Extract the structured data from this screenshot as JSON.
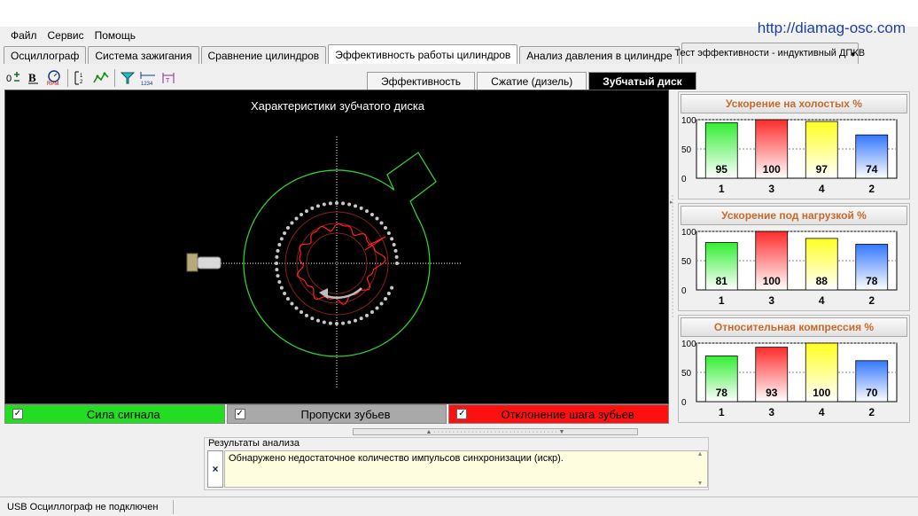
{
  "watermark": "http://diamag-osc.com",
  "menu": [
    "Файл",
    "Сервис",
    "Помощь"
  ],
  "main_tabs": [
    {
      "label": "Осциллограф"
    },
    {
      "label": "Система зажигания"
    },
    {
      "label": "Сравнение цилиндров"
    },
    {
      "label": "Эффективность работы цилиндров"
    },
    {
      "label": "Анализ давления в цилиндре"
    },
    {
      "label": "Тест эффективности - индуктивный ДПКВ"
    }
  ],
  "toolbar_icons": [
    "scale-icon",
    "bold-icon",
    "rpm-icon",
    "cursor-icon",
    "waveform-icon",
    "filter-icon",
    "numbering-icon",
    "marker-icon"
  ],
  "sub_tabs": [
    "Эффективность",
    "Сжатие (дизель)",
    "Зубчатый диск"
  ],
  "scope": {
    "title": "Характеристики зубчатого диска",
    "colors": {
      "ring": "#33cc33",
      "dots": "#c8c8c8",
      "error": "#ff2020",
      "guide": "#8a1f1f",
      "axis": "#ffffff"
    }
  },
  "legend": [
    {
      "label": "Сила сигнала",
      "color": "#22dd22",
      "checked": true
    },
    {
      "label": "Пропуски зубьев",
      "color": "#a9a9a9",
      "checked": true
    },
    {
      "label": "Отклонение шага зубьев",
      "color": "#ff1010",
      "checked": true
    }
  ],
  "charts": [
    {
      "title": "Ускорение на холостых %",
      "yticks": [
        "100",
        "50",
        "0"
      ],
      "chart_data": {
        "type": "bar",
        "categories": [
          "1",
          "3",
          "4",
          "2"
        ],
        "values": [
          95,
          100,
          97,
          74
        ],
        "ylim": [
          0,
          100
        ],
        "colors": [
          "#33ee33",
          "#ff2b2b",
          "#ffff22",
          "#3377ff"
        ]
      }
    },
    {
      "title": "Ускорение под нагрузкой %",
      "yticks": [
        "100",
        "50",
        "0"
      ],
      "chart_data": {
        "type": "bar",
        "categories": [
          "1",
          "3",
          "4",
          "2"
        ],
        "values": [
          81,
          100,
          88,
          78
        ],
        "ylim": [
          0,
          100
        ],
        "colors": [
          "#33ee33",
          "#ff2b2b",
          "#ffff22",
          "#3377ff"
        ]
      }
    },
    {
      "title": "Относительная компрессия %",
      "yticks": [
        "100",
        "50",
        "0"
      ],
      "chart_data": {
        "type": "bar",
        "categories": [
          "1",
          "3",
          "4",
          "2"
        ],
        "values": [
          78,
          93,
          100,
          70
        ],
        "ylim": [
          0,
          100
        ],
        "colors": [
          "#33ee33",
          "#ff2b2b",
          "#ffff22",
          "#3377ff"
        ]
      }
    }
  ],
  "results": {
    "title": "Результаты анализа",
    "close": "×",
    "text": "Обнаружено недостаточное количество импульсов синхронизации (искр)."
  },
  "status": "USB Осциллограф не подключен"
}
